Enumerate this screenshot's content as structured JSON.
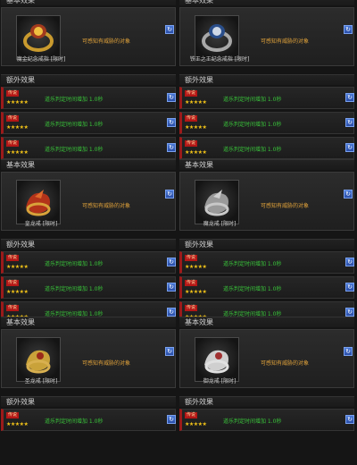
{
  "labels": {
    "basic_effect": "基本效果",
    "extra_effect": "额外效果",
    "description": "可感知有威胁的对象",
    "effect_badge": "传说",
    "stars": "★★★★★",
    "effect_text": "道乐判定时间增加 1.0秒",
    "refresh_icon": "↻"
  },
  "rows": [
    {
      "left": {
        "name": "魔金纪念戒指 [限时]",
        "icon": "gold-ring-icon"
      },
      "right": {
        "name": "铁王之王纪念戒指 [限时]",
        "icon": "silver-ring-icon"
      }
    },
    {
      "left": {
        "name": "皇龙戒 [限时]",
        "icon": "red-dragon-ring-icon"
      },
      "right": {
        "name": "魔龙戒 [限时]",
        "icon": "silver-dragon-ring-icon"
      }
    },
    {
      "left": {
        "name": "圣龙戒 [限时]",
        "icon": "gold-dragon-ring-icon"
      },
      "right": {
        "name": "御龙戒 [限时]",
        "icon": "white-dragon-ring-icon"
      }
    }
  ],
  "colors": {
    "description": "#e0a23a",
    "effect_text": "#39c43a",
    "stars": "#f2c318",
    "badge": "#b31616"
  }
}
